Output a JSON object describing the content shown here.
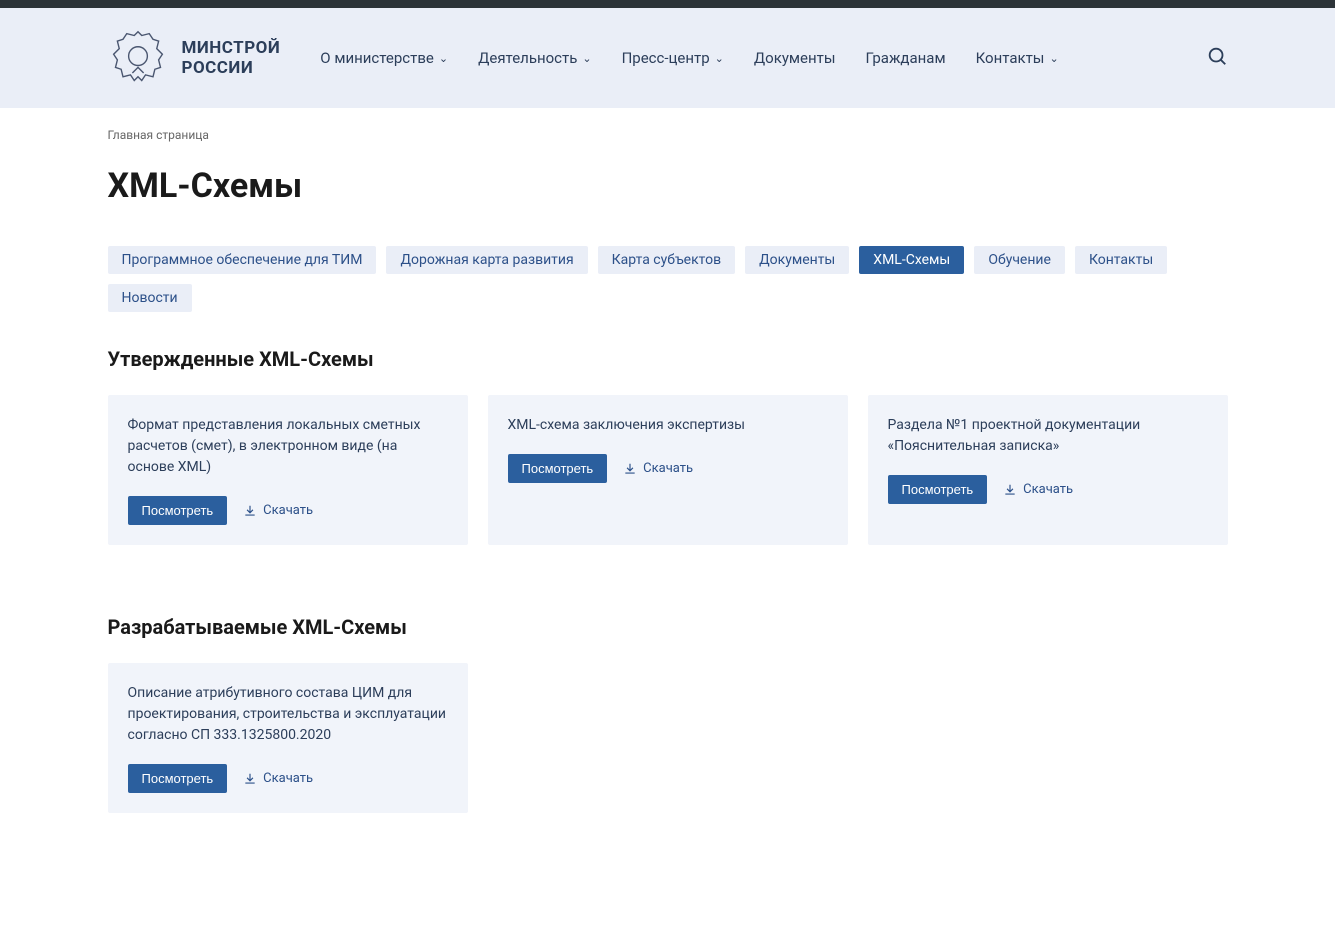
{
  "header": {
    "logo_line1": "МИНСТРОЙ",
    "logo_line2": "РОССИИ",
    "nav": [
      {
        "label": "О министерстве",
        "hasDropdown": true
      },
      {
        "label": "Деятельность",
        "hasDropdown": true
      },
      {
        "label": "Пресс-центр",
        "hasDropdown": true
      },
      {
        "label": "Документы",
        "hasDropdown": false
      },
      {
        "label": "Гражданам",
        "hasDropdown": false
      },
      {
        "label": "Контакты",
        "hasDropdown": true
      }
    ]
  },
  "breadcrumb": "Главная страница",
  "page_title": "XML-Схемы",
  "tabs": [
    {
      "label": "Программное обеспечение для ТИМ",
      "active": false
    },
    {
      "label": "Дорожная карта развития",
      "active": false
    },
    {
      "label": "Карта субъектов",
      "active": false
    },
    {
      "label": "Документы",
      "active": false
    },
    {
      "label": "XML-Схемы",
      "active": true
    },
    {
      "label": "Обучение",
      "active": false
    },
    {
      "label": "Контакты",
      "active": false
    },
    {
      "label": "Новости",
      "active": false
    }
  ],
  "sections": [
    {
      "title": "Утвержденные XML-Схемы",
      "cards": [
        {
          "title": "Формат представления локальных сметных расчетов (смет), в электронном виде (на основе XML)"
        },
        {
          "title": "XML-схема заключения экспертизы"
        },
        {
          "title": "Раздела №1 проектной документации «Пояснительная записка»"
        }
      ]
    },
    {
      "title": "Разрабатываемые XML-Схемы",
      "cards": [
        {
          "title": "Описание атрибутивного состава ЦИМ для проектирования, строительства и эксплуатации согласно СП 333.1325800.2020"
        }
      ]
    }
  ],
  "labels": {
    "view": "Посмотреть",
    "download": "Скачать"
  }
}
